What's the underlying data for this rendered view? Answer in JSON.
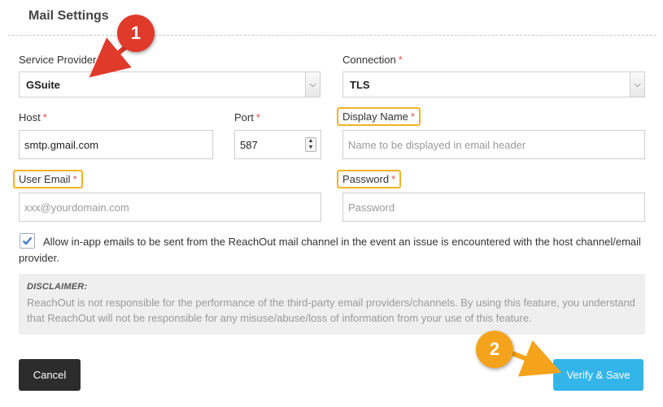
{
  "section": {
    "title": "Mail Settings"
  },
  "fields": {
    "service_provider": {
      "label": "Service Provider",
      "value": "GSuite"
    },
    "connection": {
      "label": "Connection",
      "value": "TLS"
    },
    "host": {
      "label": "Host",
      "value": "smtp.gmail.com"
    },
    "port": {
      "label": "Port",
      "value": "587"
    },
    "display_name": {
      "label": "Display Name",
      "placeholder": "Name to be displayed in email header"
    },
    "user_email": {
      "label": "User Email",
      "placeholder": "xxx@yourdomain.com"
    },
    "password": {
      "label": "Password",
      "placeholder": "Password"
    },
    "required_marker": "*"
  },
  "consent": {
    "checked": true,
    "text": "Allow in-app emails to be sent from the ReachOut mail channel in the event an issue is encountered with the host channel/email provider."
  },
  "disclaimer": {
    "title": "DISCLAIMER:",
    "body": "ReachOut is not responsible for the performance of the third-party email providers/channels. By using this feature, you understand that ReachOut will not be responsible for any misuse/abuse/loss of information from your use of this feature."
  },
  "buttons": {
    "cancel": "Cancel",
    "save": "Verify & Save"
  },
  "annotations": {
    "badge1": "1",
    "badge2": "2"
  },
  "colors": {
    "accent": "#34b5ea",
    "highlight": "#f0b429",
    "badge1": "#e03a2a",
    "badge2": "#f5a31a",
    "required": "#e05050"
  }
}
